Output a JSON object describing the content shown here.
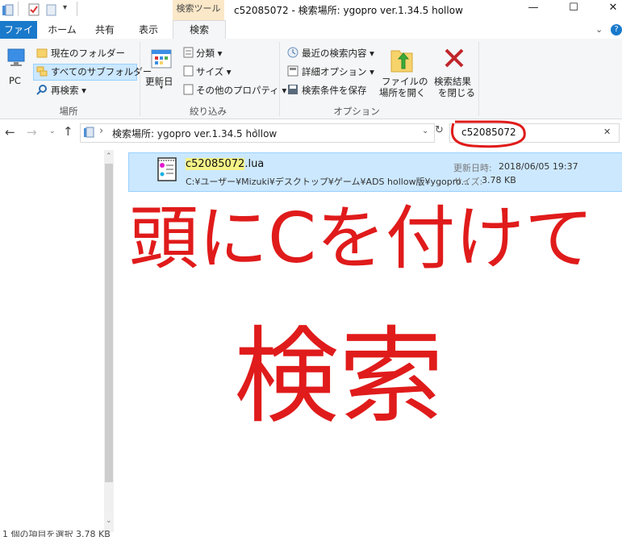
{
  "title_bar": {
    "context_tab": "検索ツール",
    "window_title": "c52085072 - 検索場所: ygopro ver.1.34.5 hollow",
    "min": "—",
    "max": "☐",
    "close": "✕"
  },
  "menu_tabs": [
    "ファイル",
    "ホーム",
    "共有",
    "表示",
    "検索"
  ],
  "ribbon": {
    "location_group": {
      "pc": "PC",
      "current_folder": "現在のフォルダー",
      "all_subfolders": "すべてのサブフォルダー",
      "research": "再検索 ▾",
      "label": "場所"
    },
    "refine_group": {
      "modified_date": "更新日",
      "category": "分類 ▾",
      "size": "サイズ ▾",
      "other_props": "その他のプロパティ ▾",
      "label": "絞り込み"
    },
    "options_group": {
      "recent": "最近の検索内容 ▾",
      "advanced": "詳細オプション ▾",
      "save_search": "検索条件を保存",
      "open_location_1": "ファイルの",
      "open_location_2": "場所を開く",
      "close_1": "検索結果",
      "close_2": "を閉じる",
      "label": "オプション"
    }
  },
  "address_bar": {
    "path": "検索場所: ygopro ver.1.34.5 hollow",
    "chevron": "›"
  },
  "search": {
    "query": "c52085072",
    "clear": "✕"
  },
  "result": {
    "name_highlight": "c52085072",
    "name_ext": ".lua",
    "path": "C:¥ユーザー¥Mizuki¥デスクトップ¥ゲーム¥ADS hollow版¥ygopro...",
    "modified_label": "更新日時:",
    "modified_value": "2018/06/05 19:37",
    "size_label": "サイズ:",
    "size_value": "3.78 KB"
  },
  "status": "1 個の項目を選択  3.78 KB",
  "annotation": {
    "line1": "頭にCを付けて",
    "line2": "検索"
  },
  "colors": {
    "accent": "#1979ca",
    "annotation": "#e01b1b",
    "selection": "#cce8ff",
    "context_tab": "#fbe8c8"
  }
}
